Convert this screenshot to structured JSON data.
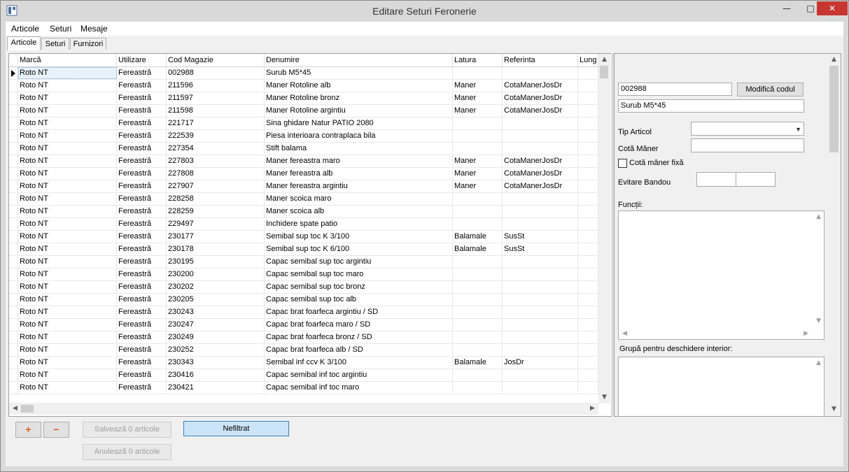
{
  "window": {
    "title": "Editare Seturi Feronerie"
  },
  "menu": [
    {
      "label": "Articole"
    },
    {
      "label": "Seturi"
    },
    {
      "label": "Mesaje"
    }
  ],
  "tabs": [
    {
      "label": "Articole",
      "active": true
    },
    {
      "label": "Seturi",
      "active": false
    },
    {
      "label": "Furnizori",
      "active": false
    }
  ],
  "grid": {
    "columns": [
      "Marcă",
      "Utilizare",
      "Cod Magazie",
      "Denumire",
      "Latura",
      "Referinta",
      "Lung"
    ],
    "rows": [
      [
        "Roto NT",
        "Fereastră",
        "002988",
        "Surub M5*45",
        "",
        ""
      ],
      [
        "Roto NT",
        "Fereastră",
        "211596",
        "Maner Rotoline alb",
        "Maner",
        "CotaManerJosDr"
      ],
      [
        "Roto NT",
        "Fereastră",
        "211597",
        "Maner Rotoline bronz",
        "Maner",
        "CotaManerJosDr"
      ],
      [
        "Roto NT",
        "Fereastră",
        "211598",
        "Maner Rotoline argintiu",
        "Maner",
        "CotaManerJosDr"
      ],
      [
        "Roto NT",
        "Fereastră",
        "221717",
        "Sina ghidare Natur PATIO 2080",
        "",
        ""
      ],
      [
        "Roto NT",
        "Fereastră",
        "222539",
        "Piesa interioara contraplaca bila",
        "",
        ""
      ],
      [
        "Roto NT",
        "Fereastră",
        "227354",
        "Stift balama",
        "",
        ""
      ],
      [
        "Roto NT",
        "Fereastră",
        "227803",
        "Maner fereastra maro",
        "Maner",
        "CotaManerJosDr"
      ],
      [
        "Roto NT",
        "Fereastră",
        "227808",
        "Maner fereastra alb",
        "Maner",
        "CotaManerJosDr"
      ],
      [
        "Roto NT",
        "Fereastră",
        "227907",
        "Maner fereastra argintiu",
        "Maner",
        "CotaManerJosDr"
      ],
      [
        "Roto NT",
        "Fereastră",
        "228258",
        "Maner scoica maro",
        "",
        ""
      ],
      [
        "Roto NT",
        "Fereastră",
        "228259",
        "Maner scoica alb",
        "",
        ""
      ],
      [
        "Roto NT",
        "Fereastră",
        "229497",
        "Inchidere spate patio",
        "",
        ""
      ],
      [
        "Roto NT",
        "Fereastră",
        "230177",
        "Semibal sup toc K 3/100",
        "Balamale",
        "SusSt"
      ],
      [
        "Roto NT",
        "Fereastră",
        "230178",
        "Semibal sup toc K 6/100",
        "Balamale",
        "SusSt"
      ],
      [
        "Roto NT",
        "Fereastră",
        "230195",
        "Capac semibal sup toc argintiu",
        "",
        ""
      ],
      [
        "Roto NT",
        "Fereastră",
        "230200",
        "Capac semibal sup toc maro",
        "",
        ""
      ],
      [
        "Roto NT",
        "Fereastră",
        "230202",
        "Capac semibal sup toc bronz",
        "",
        ""
      ],
      [
        "Roto NT",
        "Fereastră",
        "230205",
        "Capac semibal sup toc alb",
        "",
        ""
      ],
      [
        "Roto NT",
        "Fereastră",
        "230243",
        "Capac brat foarfeca argintiu / SD",
        "",
        ""
      ],
      [
        "Roto NT",
        "Fereastră",
        "230247",
        "Capac brat foarfeca maro / SD",
        "",
        ""
      ],
      [
        "Roto NT",
        "Fereastră",
        "230249",
        "Capac brat foarfeca bronz / SD",
        "",
        ""
      ],
      [
        "Roto NT",
        "Fereastră",
        "230252",
        "Capac brat foarfeca alb / SD",
        "",
        ""
      ],
      [
        "Roto NT",
        "Fereastră",
        "230343",
        "Semibal inf ccv K 3/100",
        "Balamale",
        "JosDr"
      ],
      [
        "Roto NT",
        "Fereastră",
        "230416",
        "Capac semibal inf toc argintiu",
        "",
        ""
      ],
      [
        "Roto NT",
        "Fereastră",
        "230421",
        "Capac semibal inf toc maro",
        "",
        ""
      ]
    ]
  },
  "detail": {
    "code_value": "002988",
    "modify_code_label": "Modifică codul",
    "name_value": "Surub M5*45",
    "tip_articol_label": "Tip Articol",
    "tip_articol_value": "",
    "cota_maner_label": "Cotă Mâner",
    "cota_maner_value": "",
    "cota_fixa_label": "Cotă mâner fixă",
    "evitare_bandou_label": "Evitare Bandou",
    "functii_label": "Funcții:",
    "grupa_label": "Grupă pentru deschidere interior:"
  },
  "actions": {
    "add_symbol": "+",
    "remove_symbol": "−",
    "save_label": "Salvează 0 articole",
    "cancel_label": "Anulează 0 articole",
    "filter_label": "Nefiltrat"
  },
  "colors": {
    "accent": "#cce4f7",
    "close_button": "#c7372f",
    "add_remove_icons": "#e05a1c"
  }
}
